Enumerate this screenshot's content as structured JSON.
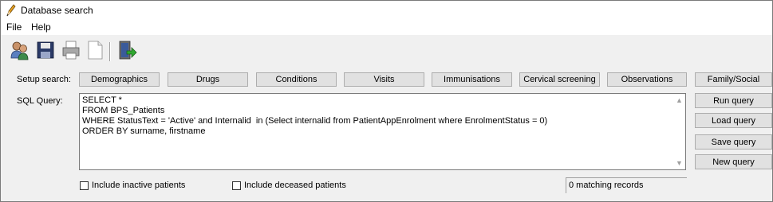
{
  "window": {
    "title": "Database search",
    "icon": "pencil-icon"
  },
  "menu": {
    "file": "File",
    "help": "Help"
  },
  "toolbar": {
    "buttons": [
      {
        "icon": "patients-icon"
      },
      {
        "icon": "save-icon"
      },
      {
        "icon": "print-icon"
      },
      {
        "icon": "new-document-icon"
      },
      {
        "icon": "exit-icon"
      }
    ]
  },
  "setup": {
    "label": "Setup search:",
    "buttons": [
      "Demographics",
      "Drugs",
      "Conditions",
      "Visits",
      "Immunisations",
      "Cervical screening",
      "Observations",
      "Family/Social"
    ]
  },
  "sql": {
    "label": "SQL Query:",
    "lines": [
      "SELECT *",
      "FROM BPS_Patients",
      "WHERE StatusText = 'Active' and Internalid  in (Select internalid from PatientAppEnrolment where EnrolmentStatus = 0)",
      "ORDER BY surname, firstname"
    ]
  },
  "actions": {
    "run": "Run query",
    "load": "Load query",
    "save": "Save query",
    "new": "New query"
  },
  "options": {
    "inactive": {
      "label": "Include inactive patients",
      "checked": false
    },
    "deceased": {
      "label": "Include deceased patients",
      "checked": false
    }
  },
  "status": {
    "matching": "0 matching records"
  },
  "colors": {
    "button_bg": "#e1e1e1",
    "button_border": "#adadad",
    "window_bg": "#f0f0f0"
  }
}
